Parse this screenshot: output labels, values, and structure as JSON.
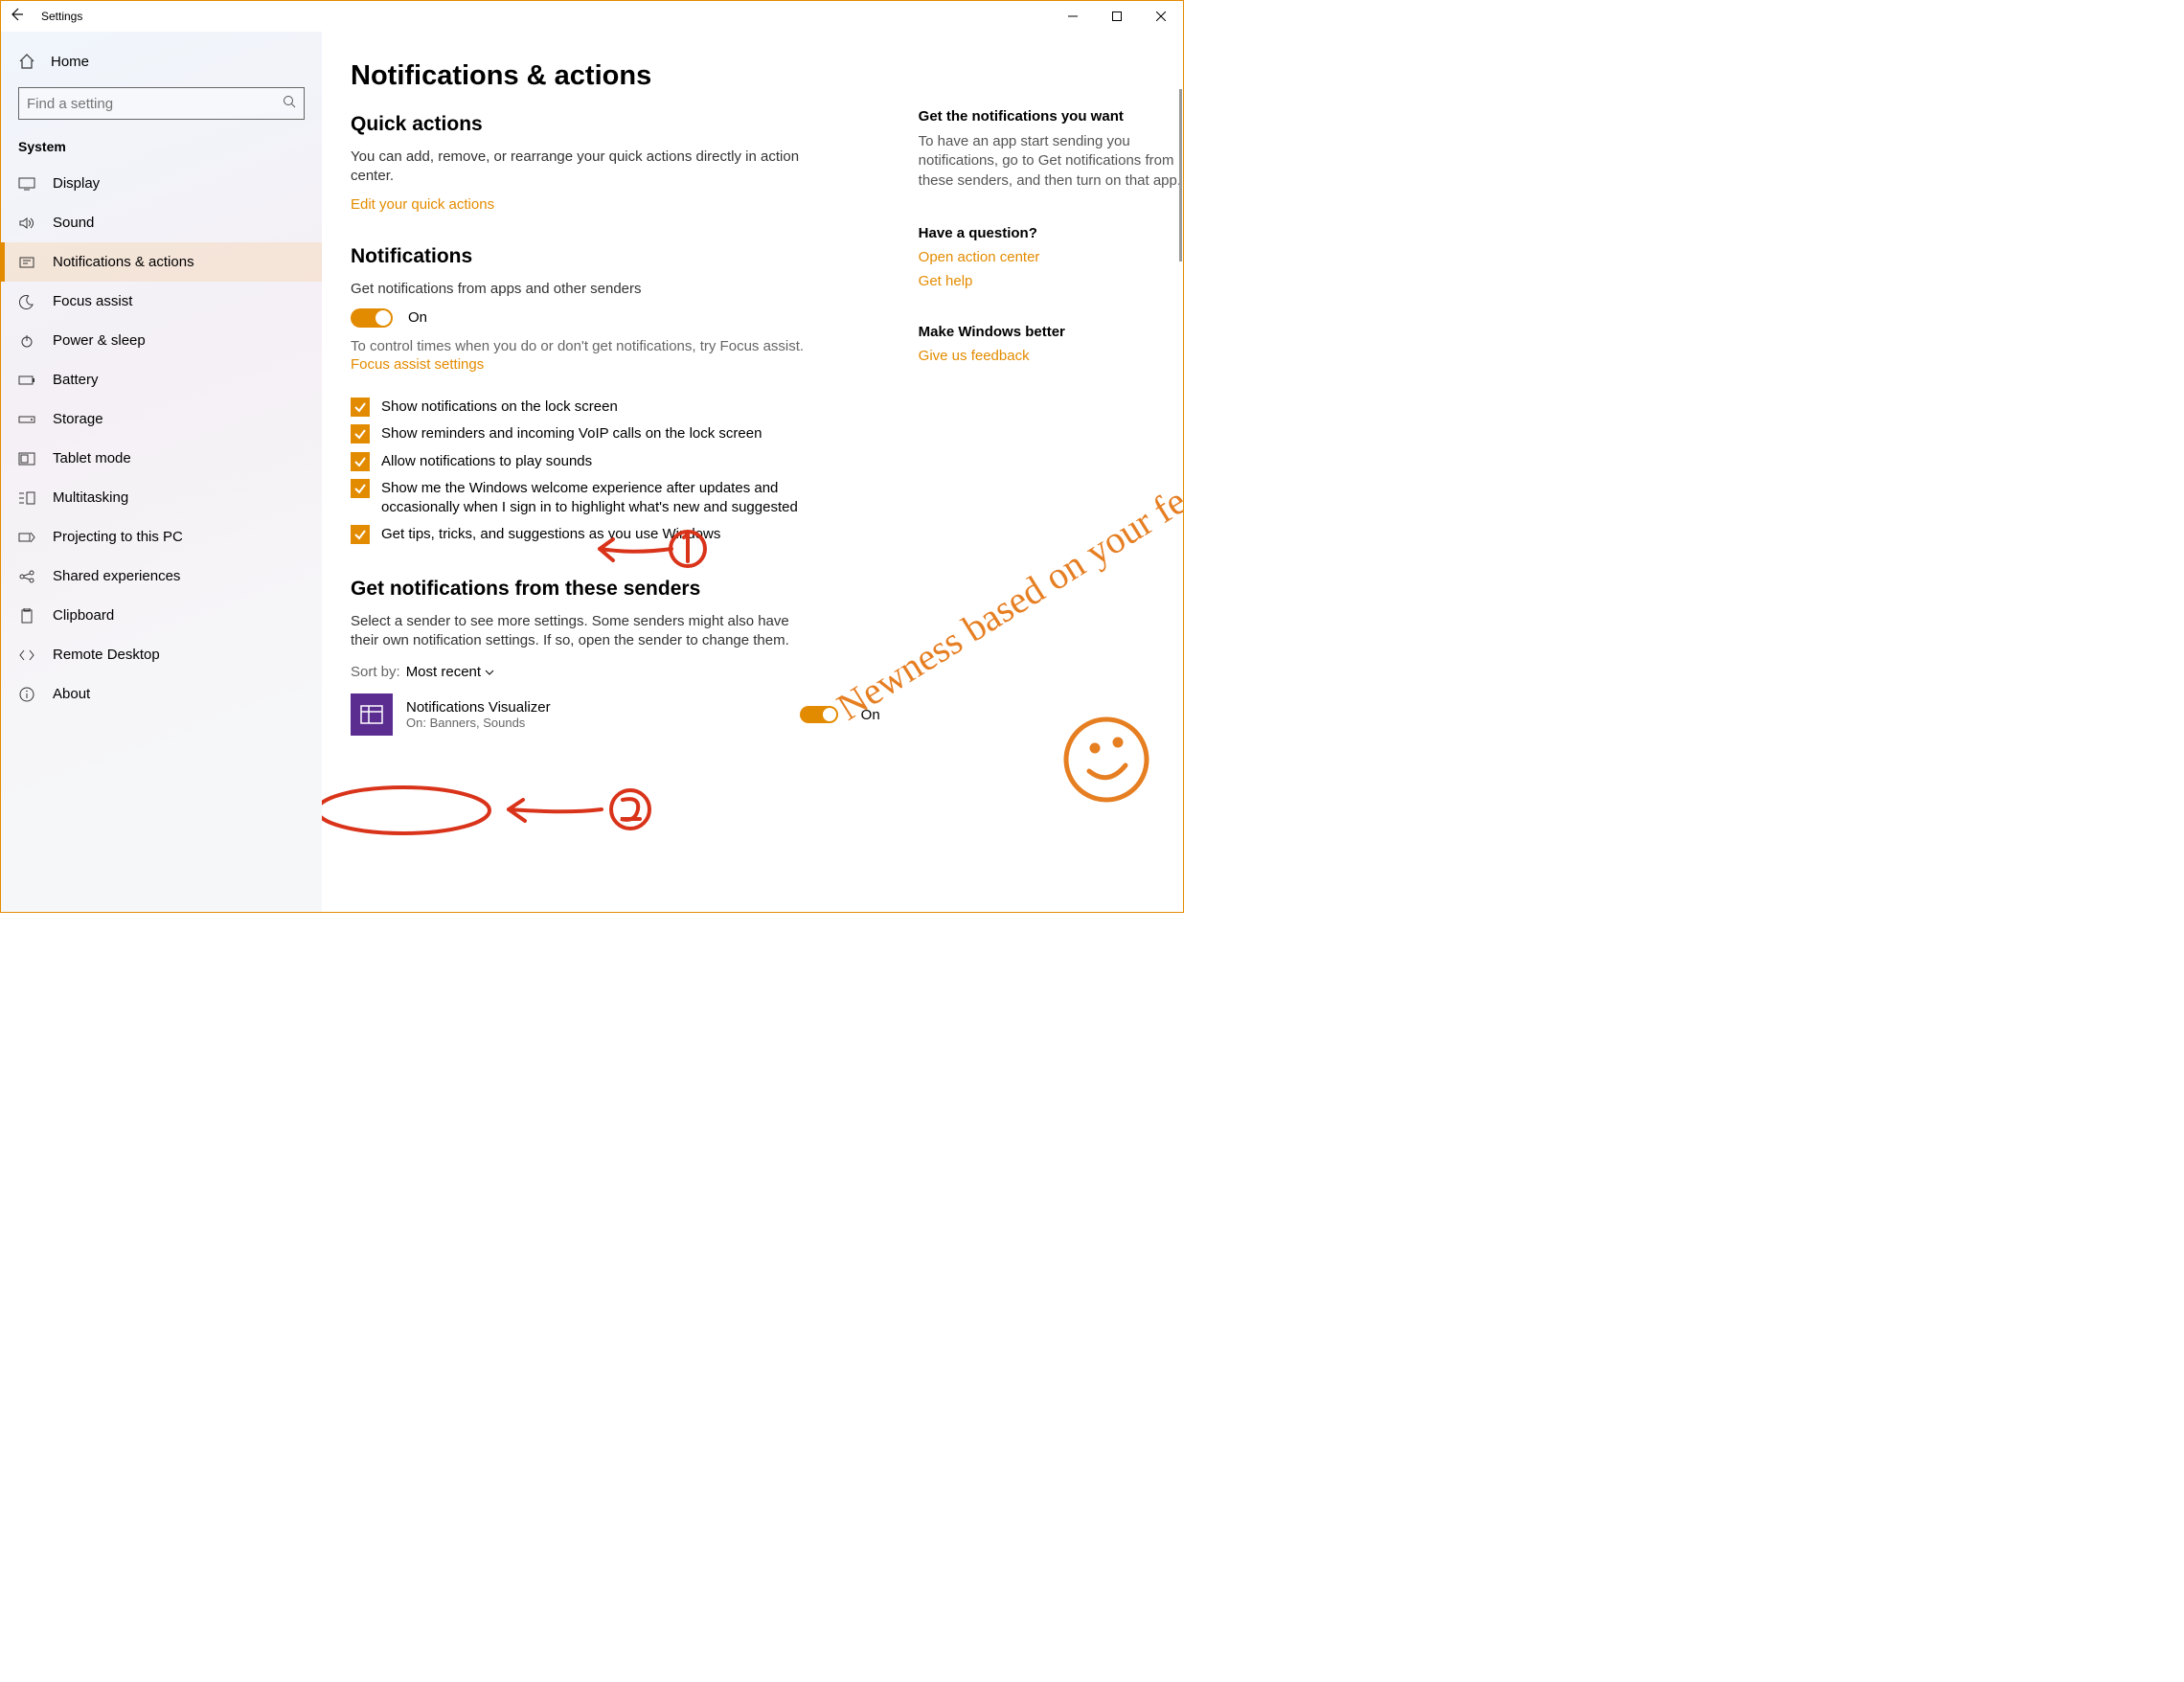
{
  "window": {
    "title": "Settings"
  },
  "sidebar": {
    "home": "Home",
    "search_placeholder": "Find a setting",
    "category": "System",
    "items": [
      {
        "label": "Display"
      },
      {
        "label": "Sound"
      },
      {
        "label": "Notifications & actions"
      },
      {
        "label": "Focus assist"
      },
      {
        "label": "Power & sleep"
      },
      {
        "label": "Battery"
      },
      {
        "label": "Storage"
      },
      {
        "label": "Tablet mode"
      },
      {
        "label": "Multitasking"
      },
      {
        "label": "Projecting to this PC"
      },
      {
        "label": "Shared experiences"
      },
      {
        "label": "Clipboard"
      },
      {
        "label": "Remote Desktop"
      },
      {
        "label": "About"
      }
    ]
  },
  "content": {
    "title": "Notifications & actions",
    "quick_actions": {
      "heading": "Quick actions",
      "desc": "You can add, remove, or rearrange your quick actions directly in action center.",
      "link": "Edit your quick actions"
    },
    "notifications": {
      "heading": "Notifications",
      "toggle_label": "Get notifications from apps and other senders",
      "toggle_state": "On",
      "desc": "To control times when you do or don't get notifications, try Focus assist.",
      "link": "Focus assist settings",
      "checkboxes": [
        {
          "label": "Show notifications on the lock screen"
        },
        {
          "label": "Show reminders and incoming VoIP calls on the lock screen"
        },
        {
          "label": "Allow notifications to play sounds"
        },
        {
          "label": "Show me the Windows welcome experience after updates and occasionally when I sign in to highlight what's new and suggested"
        },
        {
          "label": "Get tips, tricks, and suggestions as you use Windows"
        }
      ]
    },
    "senders": {
      "heading": "Get notifications from these senders",
      "desc": "Select a sender to see more settings. Some senders might also have their own notification settings. If so, open the sender to change them.",
      "sort_label": "Sort by:",
      "sort_value": "Most recent",
      "items": [
        {
          "name": "Notifications Visualizer",
          "sub": "On: Banners, Sounds",
          "state": "On"
        }
      ]
    }
  },
  "right": {
    "want": {
      "heading": "Get the notifications you want",
      "text": "To have an app start sending you notifications, go to Get notifications from these senders, and then turn on that app."
    },
    "question": {
      "heading": "Have a question?",
      "link1": "Open action center",
      "link2": "Get help"
    },
    "better": {
      "heading": "Make Windows better",
      "link": "Give us feedback"
    }
  },
  "annotations": {
    "big_note": "Newness based on your feedback"
  }
}
